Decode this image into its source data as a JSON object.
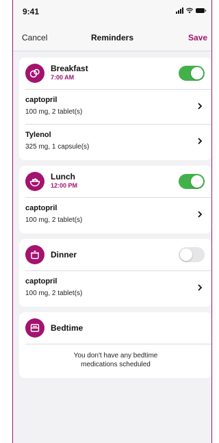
{
  "status_bar": {
    "time": "9:41"
  },
  "nav": {
    "cancel": "Cancel",
    "title": "Reminders",
    "save": "Save"
  },
  "colors": {
    "accent": "#a3136f",
    "toggle_on": "#43b14b",
    "toggle_off": "#e6e6e9"
  },
  "meals": [
    {
      "name": "Breakfast",
      "time": "7:00 AM",
      "icon": "breakfast-icon",
      "enabled": true,
      "meds": [
        {
          "name": "captopril",
          "dose": "100 mg, 2 tablet(s)"
        },
        {
          "name": "Tylenol",
          "dose": "325 mg, 1 capsule(s)"
        }
      ]
    },
    {
      "name": "Lunch",
      "time": "12:00 PM",
      "icon": "lunch-bowl-icon",
      "enabled": true,
      "meds": [
        {
          "name": "captopril",
          "dose": "100 mg, 2 tablet(s)"
        }
      ]
    },
    {
      "name": "Dinner",
      "icon": "dinner-pot-icon",
      "enabled": false,
      "meds": [
        {
          "name": "captopril",
          "dose": "100 mg, 2 tablet(s)"
        }
      ]
    },
    {
      "name": "Bedtime",
      "icon": "bed-icon",
      "empty_message_line1": "You don't have any bedtime",
      "empty_message_line2": "medications scheduled"
    }
  ]
}
